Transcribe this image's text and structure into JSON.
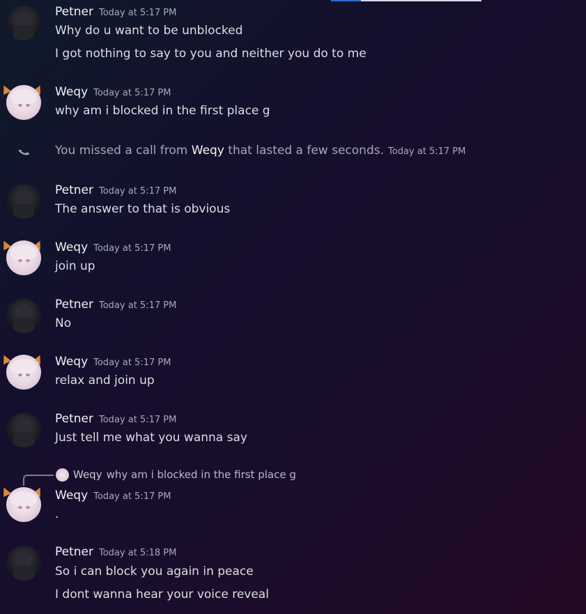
{
  "messages": [
    {
      "author": "Petner",
      "time": "Today at 5:17 PM",
      "lines": [
        "Why do u want to be unblocked",
        "I got nothing to say to you and neither you do to me"
      ]
    },
    {
      "author": "Weqy",
      "time": "Today at 5:17 PM",
      "lines": [
        "why am i blocked in the first place g"
      ]
    },
    {
      "author": "Petner",
      "time": "Today at 5:17 PM",
      "lines": [
        "The answer to that is obvious"
      ]
    },
    {
      "author": "Weqy",
      "time": "Today at 5:17 PM",
      "lines": [
        "join up"
      ]
    },
    {
      "author": "Petner",
      "time": "Today at 5:17 PM",
      "lines": [
        "No"
      ]
    },
    {
      "author": "Weqy",
      "time": "Today at 5:17 PM",
      "lines": [
        "relax and join up"
      ]
    },
    {
      "author": "Petner",
      "time": "Today at 5:17 PM",
      "lines": [
        "Just tell me what you wanna say"
      ]
    },
    {
      "author": "Weqy",
      "time": "Today at 5:17 PM",
      "lines": [
        "."
      ]
    },
    {
      "author": "Petner",
      "time": "Today at 5:18 PM",
      "lines": [
        "So i can block you again in peace",
        "I dont wanna hear your voice reveal"
      ]
    }
  ],
  "call": {
    "prefix": "You missed a call from",
    "caller": "Weqy",
    "suffix": "that lasted a few seconds.",
    "time": "Today at 5:17 PM",
    "icon": "phone-missed-icon"
  },
  "reply": {
    "author": "Weqy",
    "text": "why am i blocked in the first place g"
  }
}
